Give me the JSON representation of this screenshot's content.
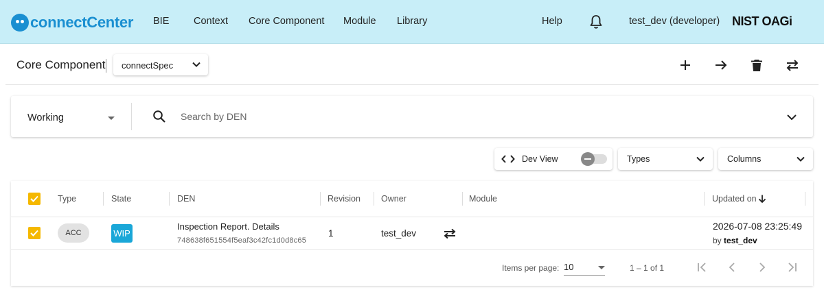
{
  "nav": {
    "logo_text": "connectCenter",
    "items": [
      "BIE",
      "Context",
      "Core Component",
      "Module",
      "Library"
    ],
    "help": "Help",
    "user": "test_dev (developer)",
    "org_logo": "NIST OAGi"
  },
  "header": {
    "title": "Core Component",
    "release": "connectSpec",
    "actions": [
      "add-icon",
      "arrow-right-icon",
      "trash-icon",
      "transfer-icon"
    ]
  },
  "search": {
    "state": "Working",
    "placeholder": "Search by DEN"
  },
  "controls": {
    "dev_view_label": "Dev View",
    "dev_view_enabled": false,
    "types_label": "Types",
    "columns_label": "Columns"
  },
  "table": {
    "columns": [
      "Type",
      "State",
      "DEN",
      "Revision",
      "Owner",
      "Module",
      "Updated on"
    ],
    "sort": "Updated on, descending",
    "rows": [
      {
        "selected": true,
        "type": "ACC",
        "state": "WIP",
        "den": "Inspection Report. Details",
        "guid": "748638f651554f5eaf3c42fc1d0d8c65",
        "revision": "1",
        "owner": "test_dev",
        "module": "",
        "updated_on": "2026-07-08 23:25:49",
        "updated_by_prefix": "by",
        "updated_by": "test_dev"
      }
    ]
  },
  "paginator": {
    "items_per_page_label": "Items per page:",
    "page_size": "10",
    "range": "1 – 1 of 1"
  },
  "colors": {
    "nav_bg": "#c8eef8",
    "brand": "#1a8fd1",
    "checkbox": "#f5b800",
    "wip_badge": "#1aa7d8",
    "type_badge": "#e2e2e2"
  }
}
